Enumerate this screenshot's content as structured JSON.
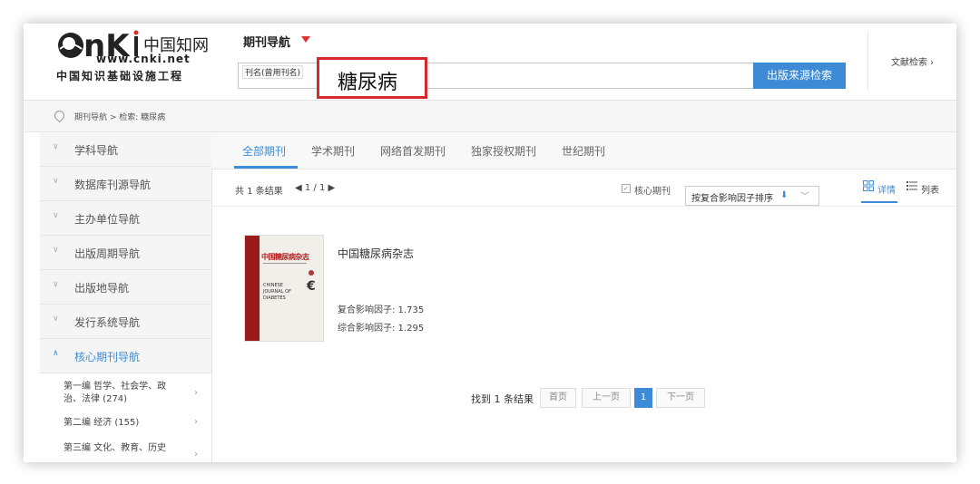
{
  "header": {
    "logo_brand": "CNKI",
    "logo_cn_top": "中国知网",
    "logo_url": "www.cnki.net",
    "logo_cn_bottom": "中国知识基础设施工程",
    "nav_title": "期刊导航",
    "search_label": "刊名(曾用刊名)",
    "search_value": "糖尿病",
    "search_button": "出版来源检索",
    "doc_search": "文献检索 ›"
  },
  "breadcrumb": "期刊导航 > 检索: 糖尿病",
  "sidebar": {
    "items": [
      {
        "label": "学科导航",
        "chev": "∨"
      },
      {
        "label": "数据库刊源导航",
        "chev": "∨"
      },
      {
        "label": "主办单位导航",
        "chev": "∨"
      },
      {
        "label": "出版周期导航",
        "chev": "∨"
      },
      {
        "label": "出版地导航",
        "chev": "∨"
      },
      {
        "label": "发行系统导航",
        "chev": "∨"
      },
      {
        "label": "核心期刊导航",
        "chev": "∧"
      }
    ],
    "subitems": [
      {
        "label": "第一编 哲学、社会学、政治、法律 (274)"
      },
      {
        "label": "第二编 经济 (155)"
      },
      {
        "label": "第三编 文化、教育、历史"
      }
    ]
  },
  "tabs": [
    "全部期刊",
    "学术期刊",
    "网络首发期刊",
    "独家授权期刊",
    "世纪期刊"
  ],
  "results": {
    "count": "共 1 条结果",
    "page": "◀ 1 / 1 ▶",
    "core_label": "核心期刊",
    "sort_label": "按复合影响因子排序",
    "view_detail": "详情",
    "view_list": "列表"
  },
  "journal": {
    "title": "中国糖尿病杂志",
    "cover_title": "中国糖尿病杂志",
    "cover_en": "CHINESE JOURNAL OF DIABETES",
    "if_composite": "复合影响因子: 1.735",
    "if_comprehensive": "综合影响因子: 1.295"
  },
  "pager": {
    "info": "找到 1 条结果",
    "first": "首页",
    "prev": "上一页",
    "current": "1",
    "next": "下一页"
  },
  "colors": {
    "accent": "#3d8bd6",
    "highlight": "#d42a2a",
    "caret": "#e03030"
  }
}
